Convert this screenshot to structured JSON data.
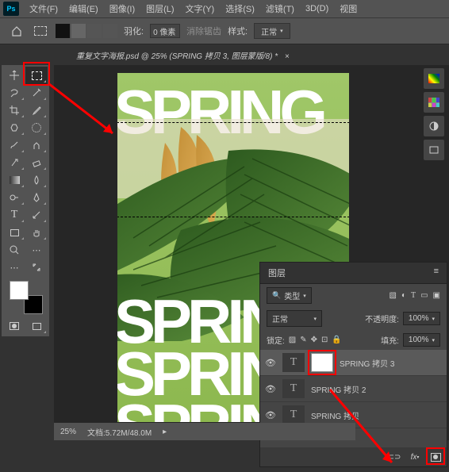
{
  "menu": {
    "file": "文件(F)",
    "edit": "编辑(E)",
    "image": "图像(I)",
    "layer": "图层(L)",
    "type": "文字(Y)",
    "select": "选择(S)",
    "filter": "滤镜(T)",
    "three_d": "3D(D)",
    "view": "视图"
  },
  "options": {
    "feather_label": "羽化:",
    "feather_val": "0 像素",
    "antialias": "消除锯齿",
    "style_label": "样式:",
    "style_val": "正常"
  },
  "doc_tab": "重复文字海报.psd @ 25% (SPRING 拷贝 3, 图层蒙版/8) *",
  "poster": {
    "word": "SPRING"
  },
  "layers_panel": {
    "title": "图层",
    "filter_label": "类型",
    "blend": "正常",
    "opacity_label": "不透明度:",
    "opacity_val": "100%",
    "lock_label": "锁定:",
    "fill_label": "填充:",
    "fill_val": "100%",
    "items": [
      {
        "name": "SPRING 拷贝 3"
      },
      {
        "name": "SPRING 拷贝 2"
      },
      {
        "name": "SPRING 拷贝"
      }
    ],
    "fx": "fx"
  },
  "status": {
    "zoom": "25%",
    "doc_size": "文档:5.72M/48.0M"
  }
}
